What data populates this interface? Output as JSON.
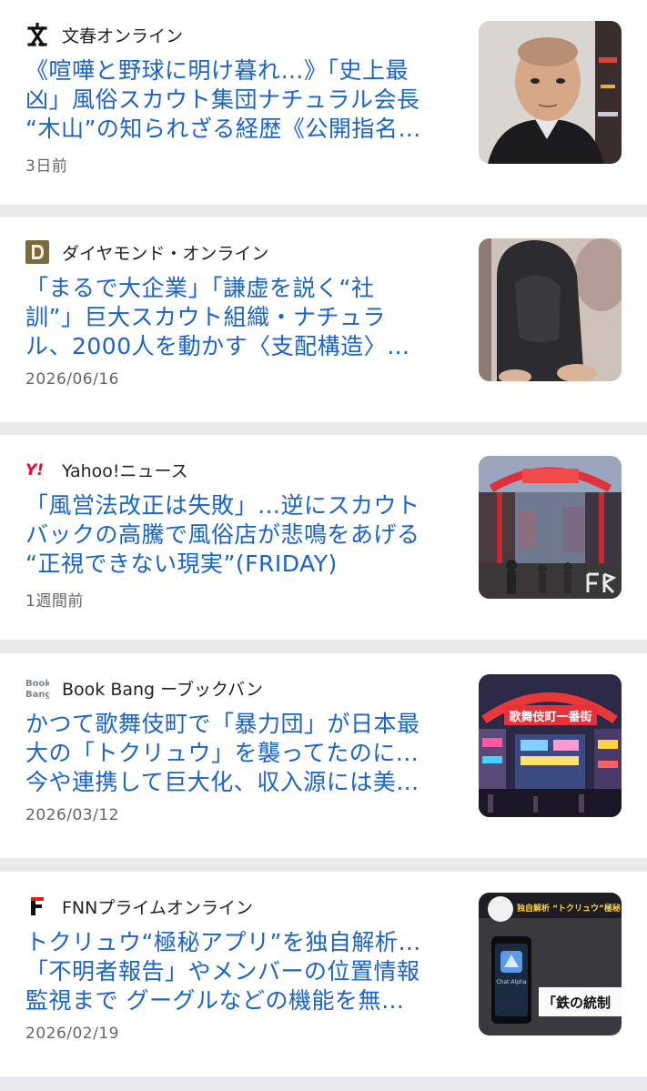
{
  "articles": [
    {
      "source": "文春オンライン",
      "source_icon": "bunshun-logo-icon",
      "headline_lines": [
        "《喧嘩と野球に明け暮れ…》「史上最",
        "凶」風俗スカウト集団ナチュラル会長",
        "“木山”の知られざる経歴《公開指名…"
      ],
      "time": "3日前",
      "thumb": "mugshot-photo"
    },
    {
      "source": "ダイヤモンド・オンライン",
      "source_icon": "diamond-logo-icon",
      "headline_lines": [
        "「まるで大企業」「謙虚を説く“社",
        "訓”」巨大スカウト組織・ナチュラ",
        "ル、2000人を動かす〈支配構造〉…"
      ],
      "time": "2026/06/16",
      "thumb": "hooded-person-photo"
    },
    {
      "source": "Yahoo!ニュース",
      "source_icon": "yahoo-logo-icon",
      "headline_lines": [
        "「風営法改正は失敗」…逆にスカウト",
        "バックの高騰で風俗店が悲鳴をあげる",
        "“正視できない現実”(FRIDAY)"
      ],
      "time": "1週間前",
      "thumb": "kabukicho-gate-photo"
    },
    {
      "source": "Book Bang ーブックバン",
      "source_icon": "bookbang-logo-icon",
      "headline_lines": [
        "かつて歌舞伎町で「暴力団」が日本最",
        "大の「トクリュウ」を襲ってたのに…",
        "今や連携して巨大化、収入源には美…"
      ],
      "time": "2026/03/12",
      "thumb": "kabukicho-neon-photo",
      "thumb_sign": "歌舞伎町一番街"
    },
    {
      "source": "FNNプライムオンライン",
      "source_icon": "fnn-logo-icon",
      "headline_lines": [
        "トクリュウ“極秘アプリ”を独自解析…",
        "「不明者報告」やメンバーの位置情報",
        "監視まで グーグルなどの機能を無…"
      ],
      "time": "2026/02/19",
      "thumb": "news-broadcast-still",
      "thumb_caption": "「鉄の統制",
      "thumb_banner": "独自解析 “トクリュウ”極秘ア",
      "thumb_app": "Chat Alpha"
    }
  ]
}
